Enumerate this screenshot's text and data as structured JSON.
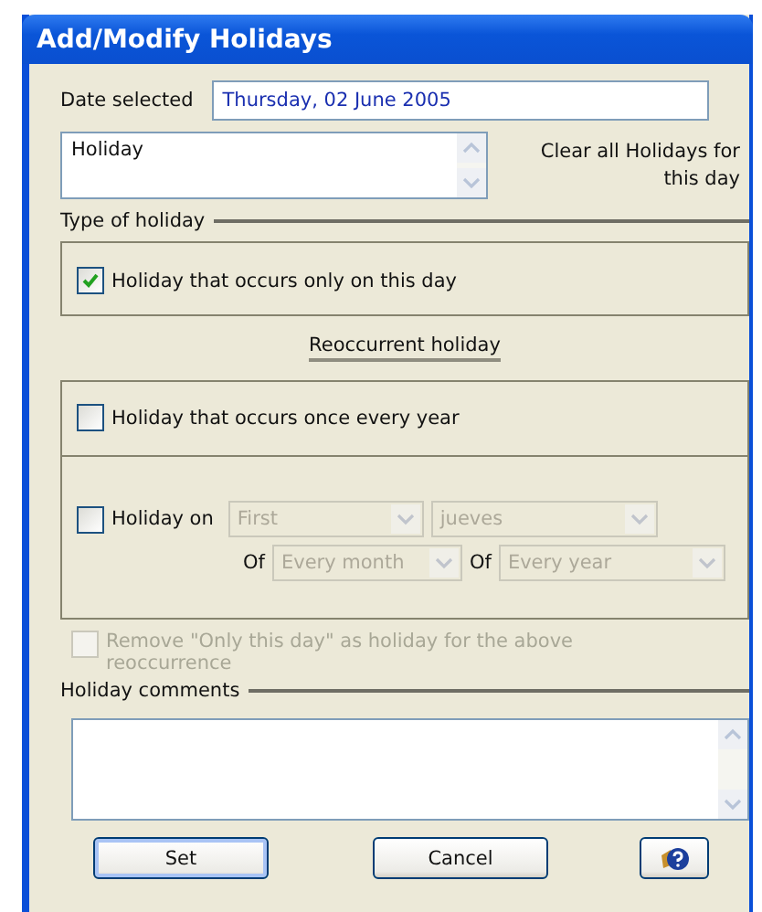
{
  "window": {
    "title": "Add/Modify Holidays"
  },
  "date_selected": {
    "label": "Date selected",
    "value": "Thursday, 02 June 2005"
  },
  "holiday_name": {
    "value": "Holiday"
  },
  "clear_button": {
    "label": "Clear all Holidays for this day"
  },
  "type_of_holiday": {
    "label": "Type of holiday",
    "options": [
      {
        "label": "Holiday that occurs only on this day",
        "checked": true
      }
    ]
  },
  "reoccurrent_label": "Reoccurrent holiday",
  "once_every_year": {
    "label": "Holiday that occurs once every year",
    "checked": false
  },
  "holiday_on": {
    "label": "Holiday on",
    "checked": false,
    "row_1": [
      {
        "value": "First",
        "disabled": true
      },
      {
        "value": "jueves",
        "disabled": true
      }
    ],
    "row_2": [
      {
        "label": "Of",
        "value": "Every month",
        "disabled": true
      },
      {
        "label": "Of",
        "value": "Every year",
        "disabled": true
      }
    ]
  },
  "remove_only_this_day": {
    "label": "Remove \"Only this day\" as holiday for the above reoccurrence",
    "checked": false,
    "disabled": true
  },
  "comments": {
    "label": "Holiday comments"
  },
  "buttons": [
    {
      "kind": "text",
      "label": "Set",
      "default": true
    },
    {
      "kind": "text",
      "label": "Cancel",
      "default": false
    },
    {
      "kind": "help",
      "default": false
    }
  ]
}
